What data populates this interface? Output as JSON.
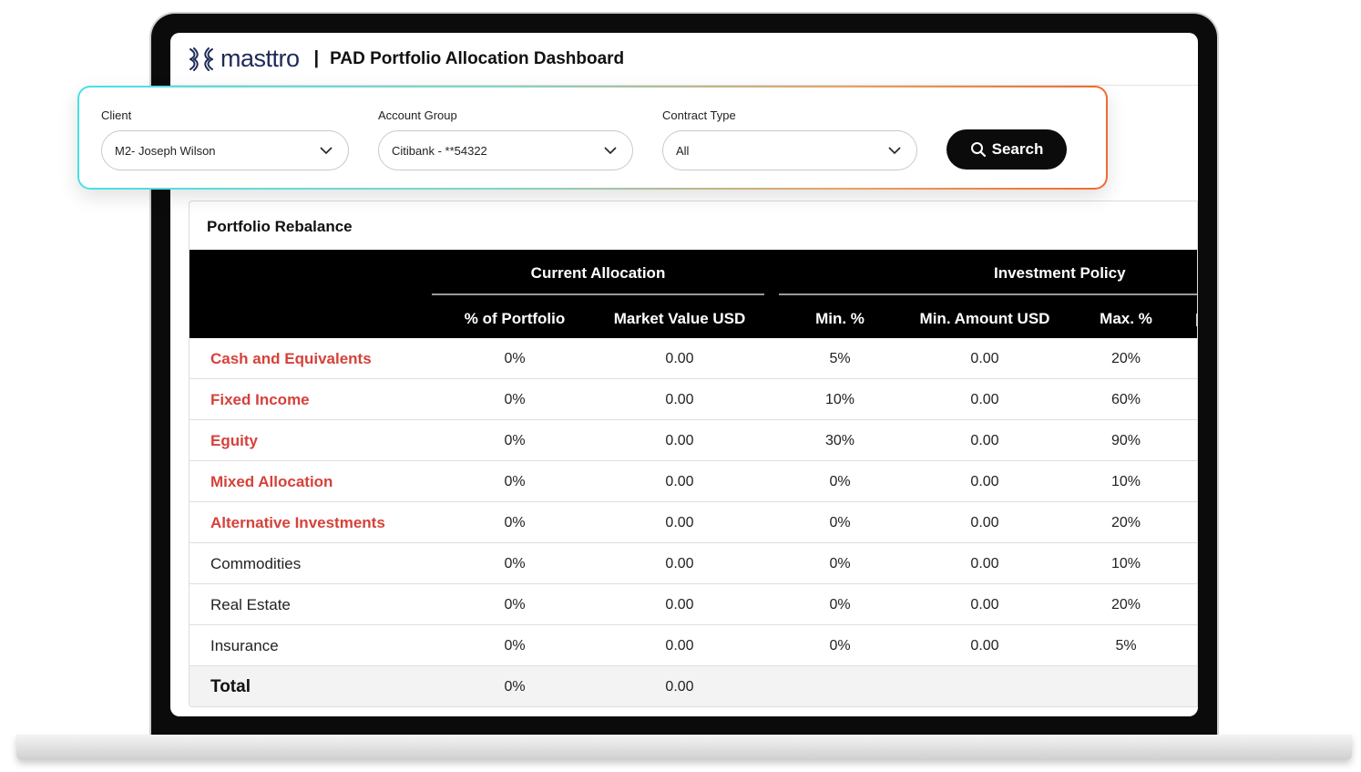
{
  "app": {
    "brand": "masttro",
    "separator": "|",
    "title": "PAD Portfolio Allocation Dashboard"
  },
  "filters": {
    "client": {
      "label": "Client",
      "value": "M2- Joseph Wilson"
    },
    "account_group": {
      "label": "Account Group",
      "value": "Citibank - **54322"
    },
    "contract_type": {
      "label": "Contract Type",
      "value": "All"
    },
    "search_label": "Search"
  },
  "table": {
    "title": "Portfolio Rebalance",
    "group_current": "Current Allocation",
    "group_policy": "Investment Policy",
    "columns": [
      "% of Portfolio",
      "Market Value USD",
      "Min. %",
      "Min. Amount USD",
      "Max. %"
    ],
    "rows": [
      {
        "category": "Cash and Equivalents",
        "pct": "0%",
        "mv": "0.00",
        "min_pct": "5%",
        "min_amt": "0.00",
        "max_pct": "20%"
      },
      {
        "category": "Fixed Income",
        "pct": "0%",
        "mv": "0.00",
        "min_pct": "10%",
        "min_amt": "0.00",
        "max_pct": "60%"
      },
      {
        "category": "Eguity",
        "pct": "0%",
        "mv": "0.00",
        "min_pct": "30%",
        "min_amt": "0.00",
        "max_pct": "90%"
      },
      {
        "category": "Mixed Allocation",
        "pct": "0%",
        "mv": "0.00",
        "min_pct": "0%",
        "min_amt": "0.00",
        "max_pct": "10%"
      },
      {
        "category": "Alternative Investments",
        "pct": "0%",
        "mv": "0.00",
        "min_pct": "0%",
        "min_amt": "0.00",
        "max_pct": "20%"
      },
      {
        "category": "Commodities",
        "pct": "0%",
        "mv": "0.00",
        "min_pct": "0%",
        "min_amt": "0.00",
        "max_pct": "10%"
      },
      {
        "category": "Real Estate",
        "pct": "0%",
        "mv": "0.00",
        "min_pct": "0%",
        "min_amt": "0.00",
        "max_pct": "20%"
      },
      {
        "category": "Insurance",
        "pct": "0%",
        "mv": "0.00",
        "min_pct": "0%",
        "min_amt": "0.00",
        "max_pct": "5%"
      }
    ],
    "total": {
      "label": "Total",
      "pct": "0%",
      "mv": "0.00"
    }
  },
  "colors": {
    "accent_red": "#d6413a",
    "brand_navy": "#1f2a5a",
    "header_black": "#000000",
    "glow_cyan": "#48e0e6",
    "glow_orange": "#f26a2e"
  },
  "icons": [
    "masttro-logo-icon",
    "chevron-down-icon",
    "search-icon"
  ]
}
